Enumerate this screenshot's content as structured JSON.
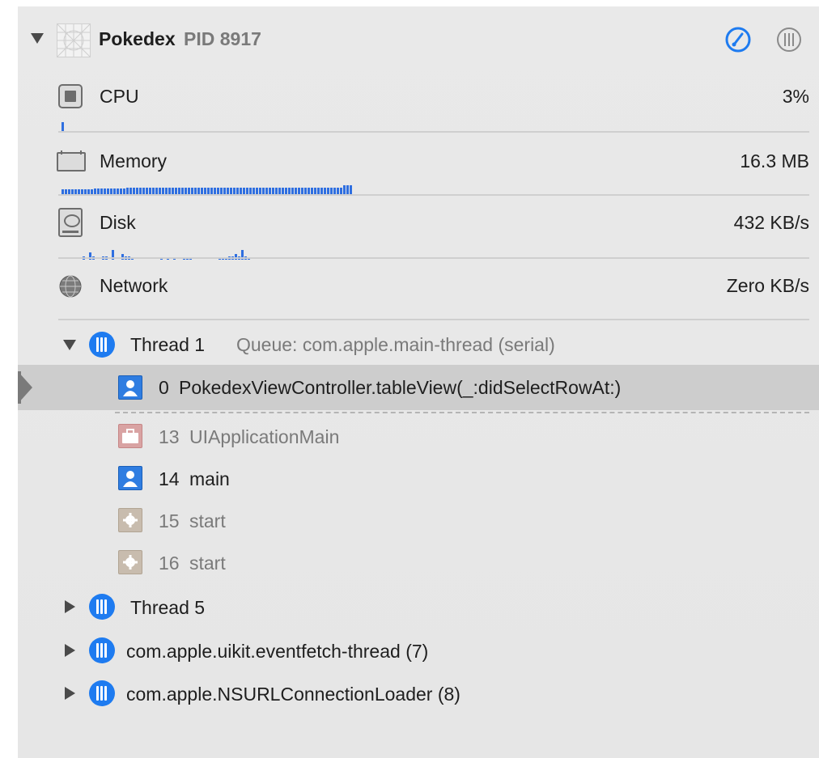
{
  "process": {
    "name": "Pokedex",
    "pid_label": "PID 8917",
    "gauge_icon": "gauge-icon",
    "threads_icon": "threads-view-icon",
    "accent": "#1e7bf0"
  },
  "gauges": {
    "cpu": {
      "label": "CPU",
      "value": "3%",
      "level": 0.03
    },
    "memory": {
      "label": "Memory",
      "value": "16.3 MB"
    },
    "disk": {
      "label": "Disk",
      "value": "432 KB/s"
    },
    "network": {
      "label": "Network",
      "value": "Zero KB/s"
    }
  },
  "thread1": {
    "title": "Thread 1",
    "queue": "Queue: com.apple.main-thread (serial)"
  },
  "frames": [
    {
      "number": "0",
      "symbol": "PokedexViewController.tableView(_:didSelectRowAt:)",
      "kind": "user",
      "selected": true
    },
    {
      "number": "13",
      "symbol": "UIApplicationMain",
      "kind": "library"
    },
    {
      "number": "14",
      "symbol": "main",
      "kind": "user"
    },
    {
      "number": "15",
      "symbol": "start",
      "kind": "system"
    },
    {
      "number": "16",
      "symbol": "start",
      "kind": "system"
    }
  ],
  "other_threads": [
    {
      "label": "Thread 5"
    },
    {
      "label": "com.apple.uikit.eventfetch-thread (7)"
    },
    {
      "label": "com.apple.NSURLConnectionLoader (8)"
    }
  ]
}
